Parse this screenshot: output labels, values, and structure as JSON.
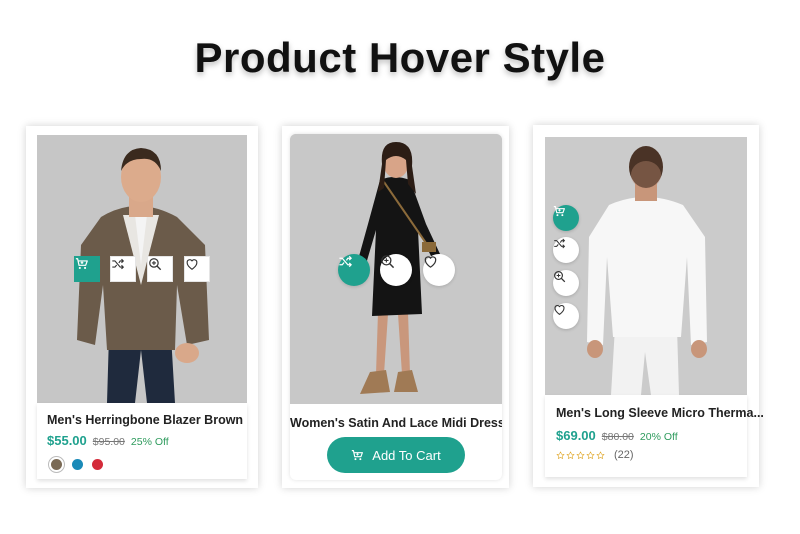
{
  "page": {
    "title": "Product Hover Style"
  },
  "colors": {
    "accent": "#1fa18e",
    "offer": "#2e9b5d",
    "image_bg": "#c9c9c9"
  },
  "products": [
    {
      "name": "Men's Herringbone Blazer Brown",
      "price": "$55.00",
      "old_price": "$95.00",
      "discount": "25% Off",
      "swatches": [
        "#7a6a55",
        "#1a8ab8",
        "#d42b3a"
      ],
      "selected_swatch": 0,
      "actions": [
        "cart-icon",
        "shuffle-icon",
        "zoom-icon",
        "heart-icon"
      ],
      "active_action": "cart-icon"
    },
    {
      "name": "Women's Satin And Lace Midi Dress",
      "add_to_cart": "Add To Cart",
      "actions": [
        "shuffle-icon",
        "zoom-icon",
        "heart-icon"
      ],
      "active_action": "shuffle-icon"
    },
    {
      "name": "Men's Long Sleeve Micro Therma...",
      "price": "$69.00",
      "old_price": "$80.00",
      "discount": "20% Off",
      "rating": 0,
      "reviews": "(22)",
      "actions": [
        "cart-icon",
        "shuffle-icon",
        "zoom-icon",
        "heart-icon"
      ],
      "active_action": "cart-icon"
    }
  ]
}
